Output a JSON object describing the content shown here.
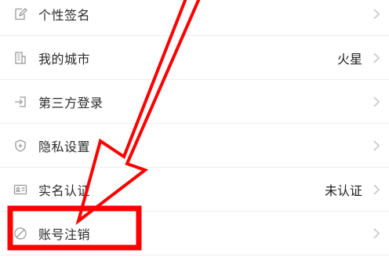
{
  "settings": {
    "items": [
      {
        "label": "个性签名",
        "value": "",
        "icon": "edit-signature-icon"
      },
      {
        "label": "我的城市",
        "value": "火星",
        "icon": "building-icon"
      },
      {
        "label": "第三方登录",
        "value": "",
        "icon": "login-icon"
      },
      {
        "label": "隐私设置",
        "value": "",
        "icon": "shield-icon"
      },
      {
        "label": "实名认证",
        "value": "未认证",
        "icon": "id-card-icon"
      },
      {
        "label": "账号注销",
        "value": "",
        "icon": "cancel-circle-icon"
      }
    ]
  },
  "annotation": {
    "arrow_color": "#ff0000",
    "highlight_color": "#ff0000",
    "highlight_target": "账号注销"
  },
  "colors": {
    "text": "#2b2b2b",
    "icon": "#9a9a9a",
    "divider": "#ededed",
    "chevron": "#c2c2c2"
  }
}
